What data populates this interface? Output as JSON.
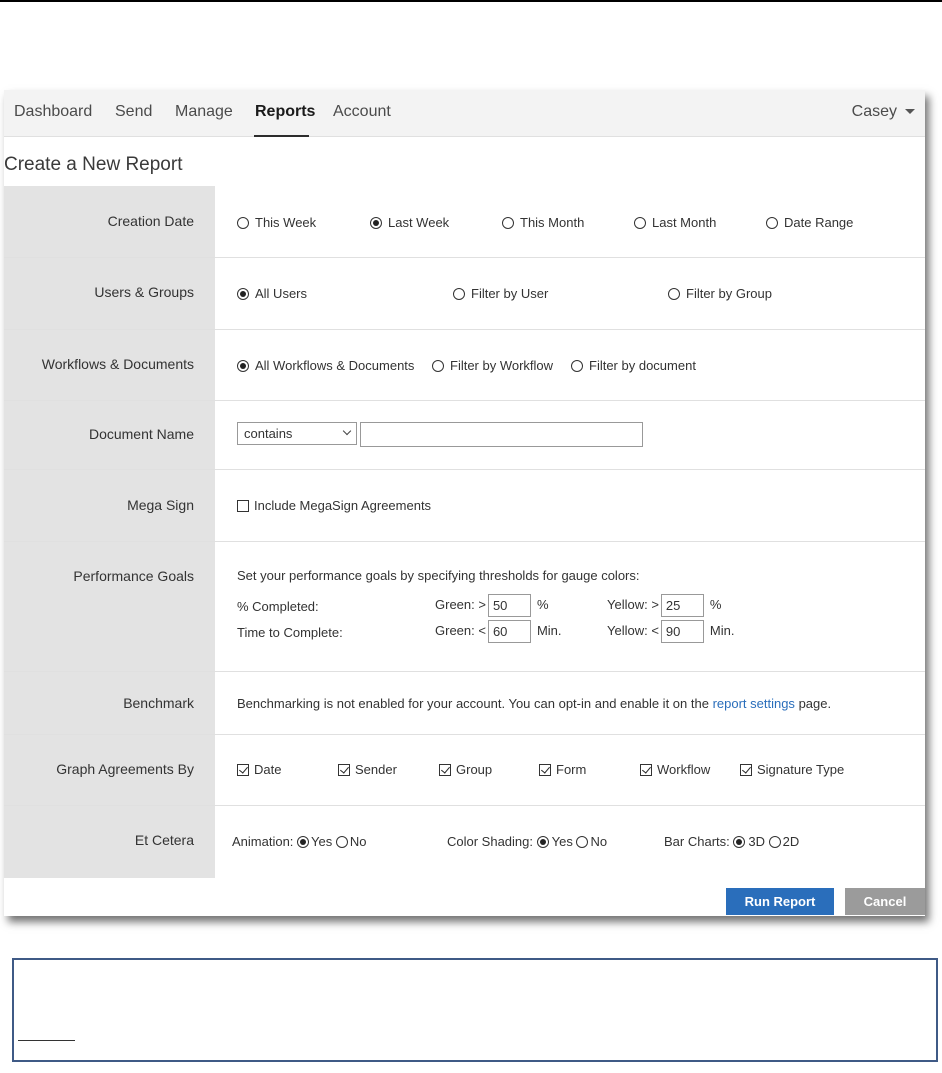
{
  "nav": {
    "items": [
      "Dashboard",
      "Send",
      "Manage",
      "Reports",
      "Account"
    ],
    "active": "Reports",
    "user": "Casey"
  },
  "page_title": "Create a New Report",
  "rows": {
    "creation_date": {
      "label": "Creation Date",
      "options": [
        "This Week",
        "Last Week",
        "This Month",
        "Last Month",
        "Date Range"
      ],
      "selected": "Last Week"
    },
    "users_groups": {
      "label": "Users & Groups",
      "options": [
        "All Users",
        "Filter by User",
        "Filter by Group"
      ],
      "selected": "All Users"
    },
    "workflows": {
      "label": "Workflows & Documents",
      "options": [
        "All Workflows & Documents",
        "Filter by Workflow",
        "Filter by document"
      ],
      "selected": "All Workflows & Documents"
    },
    "document_name": {
      "label": "Document Name",
      "select_value": "contains",
      "text_value": ""
    },
    "mega_sign": {
      "label": "Mega Sign",
      "checkbox_label": "Include MegaSign Agreements",
      "checked": false
    },
    "performance_goals": {
      "label": "Performance Goals",
      "intro": "Set your performance goals by specifying thresholds for gauge colors:",
      "completed_label": "% Completed:",
      "time_label": "Time to Complete:",
      "green_gt": "Green: >",
      "yellow_gt": "Yellow: >",
      "green_lt": "Green: <",
      "yellow_lt": "Yellow: <",
      "completed_green": "50",
      "completed_yellow": "25",
      "percent_unit": "%",
      "time_green": "60",
      "time_yellow": "90",
      "min_unit": "Min."
    },
    "benchmark": {
      "label": "Benchmark",
      "text": "Benchmarking is not enabled for your account. You can opt-in and enable it on the",
      "link": "report settings",
      "suffix": "page."
    },
    "graph_by": {
      "label": "Graph Agreements By",
      "options": [
        "Date",
        "Sender",
        "Group",
        "Form",
        "Workflow",
        "Signature Type"
      ],
      "checked": [
        true,
        true,
        true,
        true,
        true,
        true
      ]
    },
    "et_cetera": {
      "label": "Et Cetera",
      "animation_label": "Animation:",
      "color_shading_label": "Color Shading:",
      "bar_charts_label": "Bar Charts:",
      "yes": "Yes",
      "no": "No",
      "d3": "3D",
      "d2": "2D"
    }
  },
  "buttons": {
    "run": "Run Report",
    "cancel": "Cancel"
  },
  "colors": {
    "primary": "#2a6ebb",
    "cancel": "#9b9b9b",
    "label_column": "#e3e3e3",
    "note_border": "#3f5a86"
  }
}
